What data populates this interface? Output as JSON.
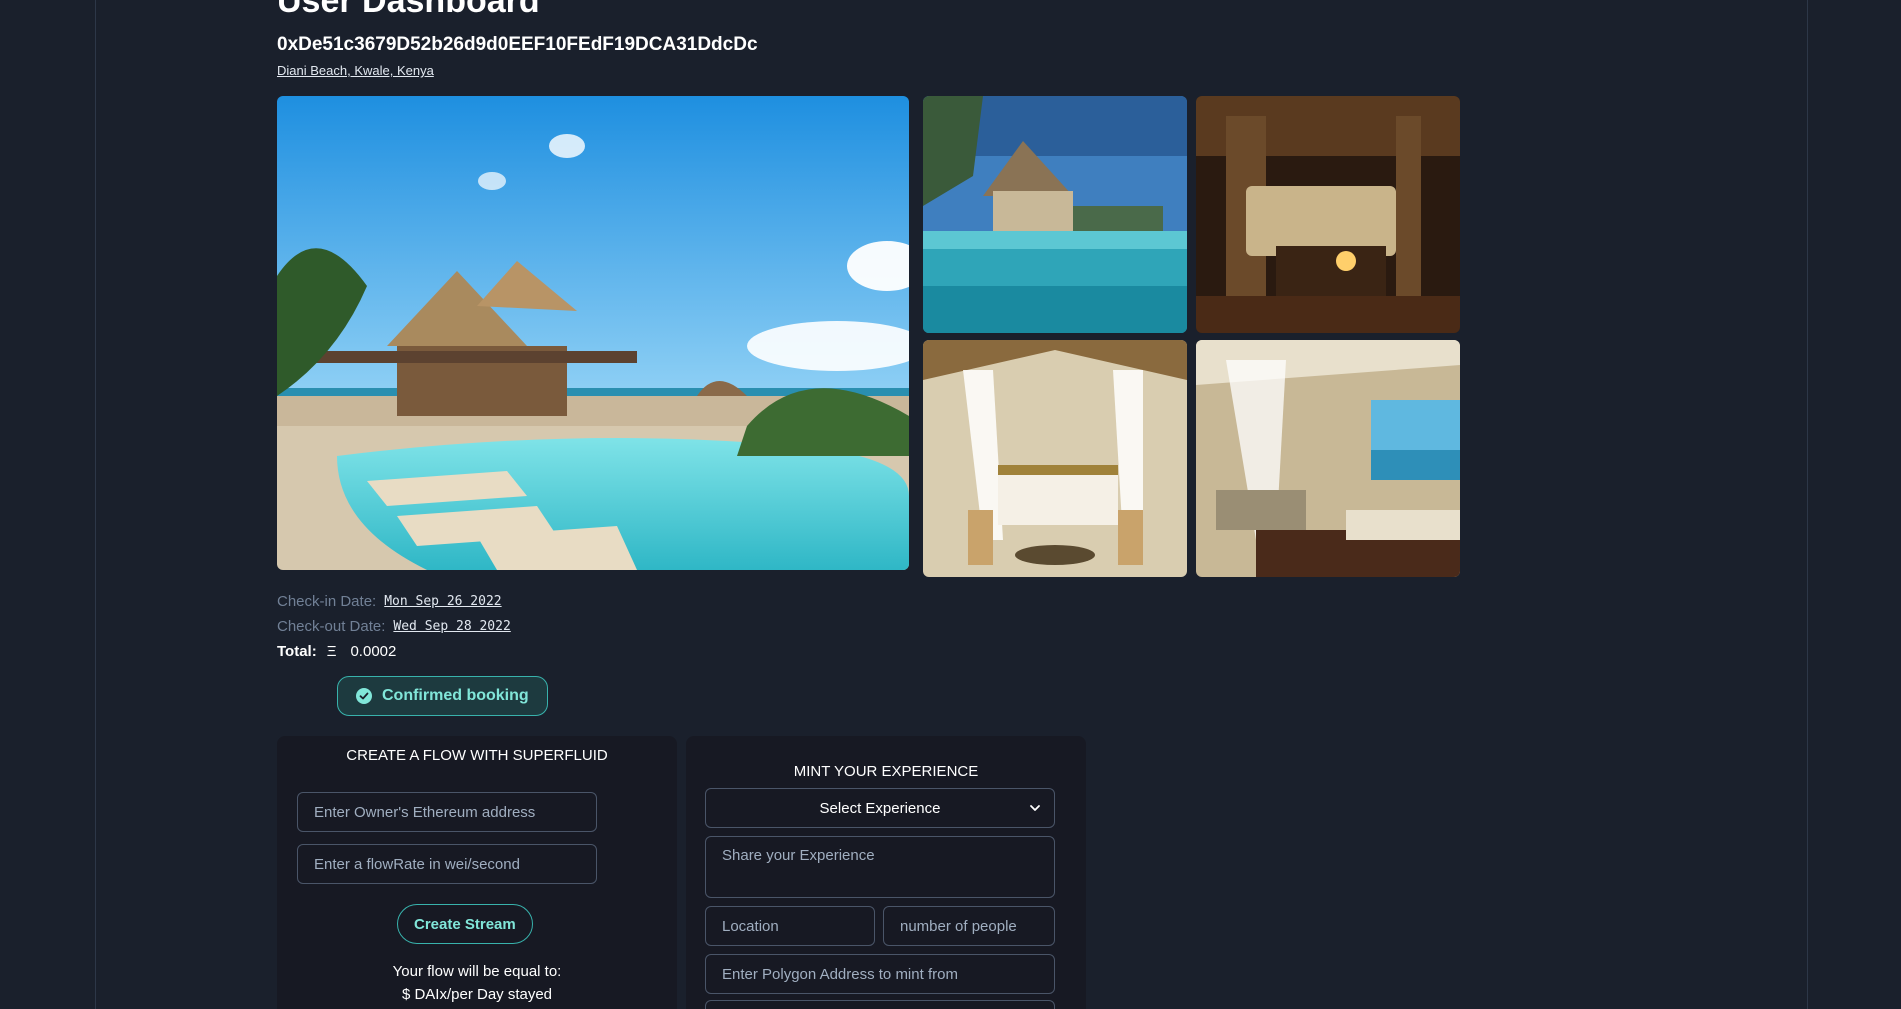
{
  "header": {
    "title": "User Dashboard",
    "wallet_address": "0xDe51c3679D52b26d9d0EEF10FEdF19DCA31DdcDc",
    "location": "Diani Beach, Kwale, Kenya"
  },
  "booking": {
    "checkin_label": "Check-in Date:",
    "checkin_value": "Mon Sep 26 2022",
    "checkout_label": "Check-out Date:",
    "checkout_value": "Wed Sep 28 2022",
    "total_label": "Total:",
    "total_symbol": "Ξ",
    "total_value": "0.0002",
    "status_badge": "Confirmed booking"
  },
  "flow_panel": {
    "title": "CREATE A FLOW WITH SUPERFLUID",
    "owner_placeholder": "Enter Owner's Ethereum address",
    "flowrate_placeholder": "Enter a flowRate in wei/second",
    "create_button": "Create Stream",
    "note_line1": "Your flow will be equal to:",
    "note_line2": "$ DAIx/per Day stayed"
  },
  "mint_panel": {
    "title": "MINT YOUR EXPERIENCE",
    "select_label": "Select Experience",
    "experience_placeholder": "Share your Experience",
    "location_placeholder": "Location",
    "people_placeholder": "number of people",
    "polygon_placeholder": "Enter Polygon Address to mint from"
  },
  "colors": {
    "background": "#1a202c",
    "panel": "#171923",
    "accent_teal": "#38b2ac",
    "accent_teal_light": "#81e6d9",
    "muted_text": "#718096"
  }
}
